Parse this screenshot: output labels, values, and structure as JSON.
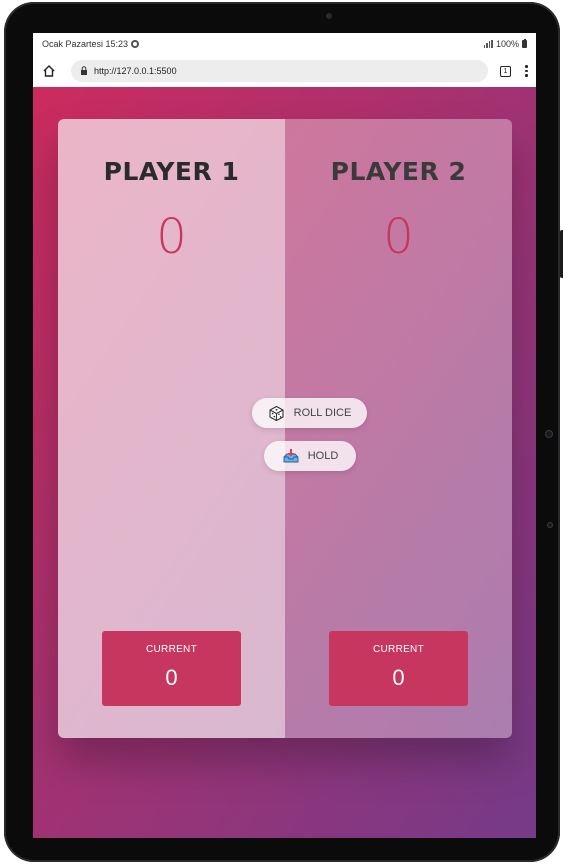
{
  "status": {
    "time": "Ocak Pazartesi 15:23",
    "battery": "100%"
  },
  "browser": {
    "url": "http://127.0.0.1:5500",
    "tab_count": "1"
  },
  "players": [
    {
      "name": "PLAYER 1",
      "score": "0",
      "current_label": "CURRENT",
      "current_score": "0"
    },
    {
      "name": "PLAYER 2",
      "score": "0",
      "current_label": "CURRENT",
      "current_score": "0"
    }
  ],
  "buttons": {
    "roll": {
      "label": "ROLL DICE",
      "icon": "dice-icon"
    },
    "hold": {
      "label": "HOLD",
      "icon": "inbox-tray-icon"
    }
  },
  "colors": {
    "gradient_start": "#cc2b5e",
    "gradient_end": "#753a88",
    "accent": "#c7365f"
  }
}
